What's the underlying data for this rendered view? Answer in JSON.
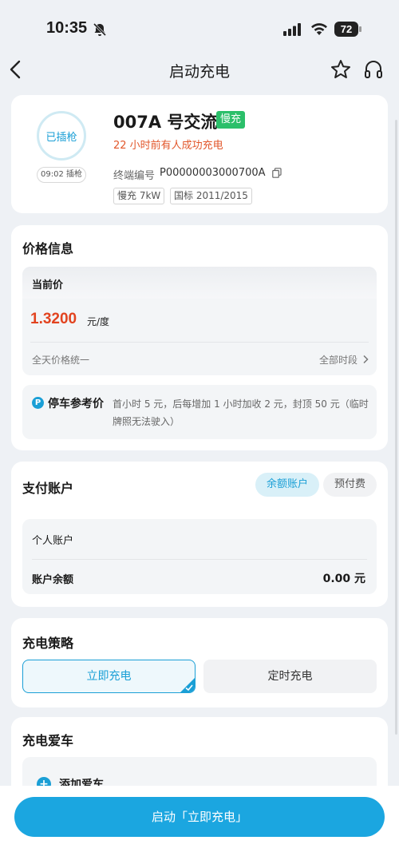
{
  "status": {
    "time": "10:35",
    "battery": "72"
  },
  "nav": {
    "title": "启动充电"
  },
  "charger": {
    "plug_state": "已插枪",
    "plug_time": "09:02 插枪",
    "name": "007A 号交流",
    "speed_badge": "慢充",
    "recent": "22 小时前有人成功充电",
    "terminal_label": "终端编号",
    "terminal_id": "P00000003000700A",
    "tags": [
      "慢充 7kW",
      "国标 2011/2015"
    ]
  },
  "price": {
    "title": "价格信息",
    "current_label": "当前价",
    "value": "1.3200",
    "unit": "元/度",
    "uniform": "全天价格统一",
    "all_periods": "全部时段",
    "parking_icon": "P",
    "parking_label": "停车参考价",
    "parking_text": "首小时 5 元，后每增加 1 小时加收 2 元，封顶 50 元（临时牌照无法驶入）"
  },
  "payment": {
    "title": "支付账户",
    "tabs": [
      "余额账户",
      "预付费"
    ],
    "personal": "个人账户",
    "balance_label": "账户余额",
    "balance_value": "0.00 元"
  },
  "strategy": {
    "title": "充电策略",
    "options": [
      "立即充电",
      "定时充电"
    ]
  },
  "car": {
    "title": "充电爱车",
    "add_label": "添加爱车"
  },
  "bottom": {
    "start_label": "启动「立即充电」"
  },
  "colors": {
    "accent": "#1ba6e0",
    "price": "#e2431f",
    "badge": "#2bbf6a",
    "warning": "#e2572b"
  }
}
